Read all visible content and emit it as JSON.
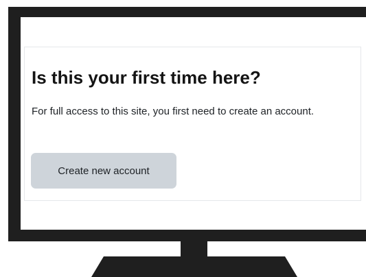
{
  "signup_card": {
    "title": "Is this your first time here?",
    "description": "For full access to this site, you first need to create an account.",
    "create_account_label": "Create new account"
  },
  "colors": {
    "monitor": "#1f1f1f",
    "screen_background": "#ffffff",
    "button_background": "#ced4da",
    "text": "#1d2125"
  }
}
